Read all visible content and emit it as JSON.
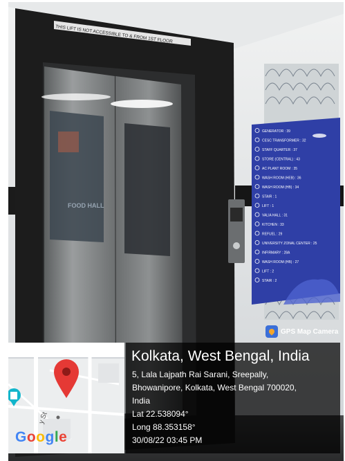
{
  "photo": {
    "lift_notice": "THIS LIFT IS NOT ACCESSIBLE TO & FROM 1ST FLOOR",
    "reflection_text": "FOOD HALL",
    "directory_items": [
      "GENERATOR : 39",
      "CESC TRANSFORMER : 32",
      "STAFF QUARTER : 37",
      "STORE (CENTRAL) : 43",
      "AC PLANT ROOM : 35",
      "WASH ROOM (HEB) : 36",
      "WASH ROOM (HB) : 34",
      "STAIR : 1",
      "LIFT : 1",
      "VALIA HALL : 31",
      "KITCHEN : 33",
      "REFUEL : 29",
      "UNIVERSITY ZONAL CENTER : 25",
      "INFIRMARY : 28A",
      "WASH ROOM (HB) : 27",
      "LIFT : 2",
      "STAIR : 2"
    ],
    "colors": {
      "directory_blue": "#2f3fa6",
      "wall": "#d9dde0",
      "steel": "#7a7d7e",
      "frame": "#1c1c1c"
    }
  },
  "gps_tag": {
    "label": "GPS Map Camera",
    "icon": "map-pin-icon"
  },
  "map": {
    "brand": [
      "G",
      "o",
      "o",
      "g",
      "l",
      "e"
    ],
    "street_label": "y St",
    "pin_icon": "location-pin-icon",
    "poi_icon": "chess-rook-icon"
  },
  "location": {
    "title": "Kolkata, West Bengal, India",
    "address_line1": "5, Lala Lajpath Rai Sarani, Sreepally,",
    "address_line2": "Bhowanipore, Kolkata, West Bengal 700020,",
    "address_line3": "India",
    "latitude": "Lat 22.538094°",
    "longitude": "Long 88.353158°",
    "datetime": "30/08/22 03:45 PM"
  }
}
